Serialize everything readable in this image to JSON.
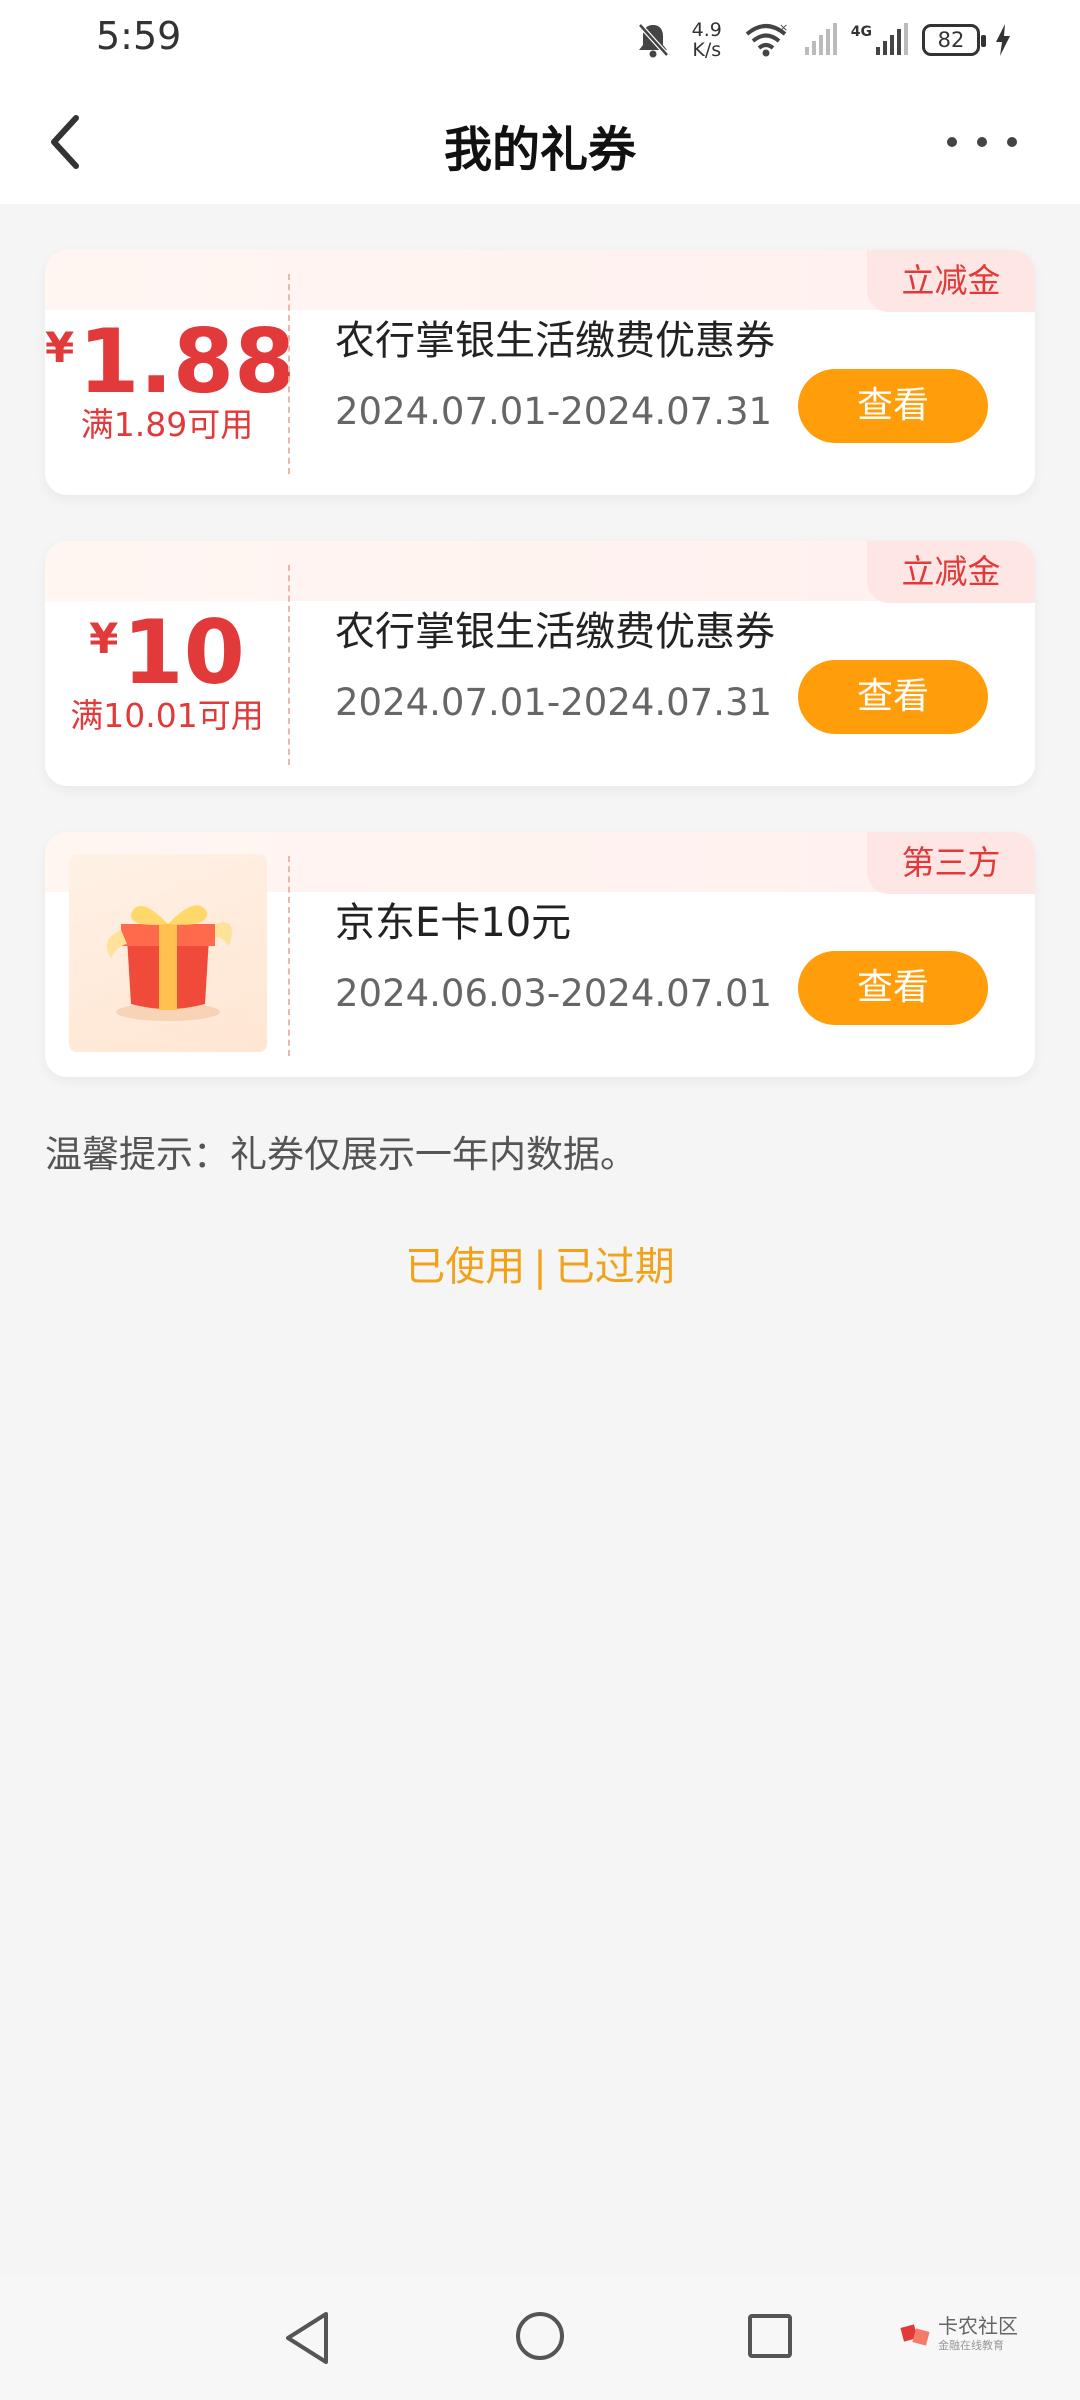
{
  "status_bar": {
    "time": "5:59",
    "net_speed_value": "4.9",
    "net_speed_unit": "K/s",
    "network_label": "4G",
    "battery": "82",
    "icons": [
      "bell-muted-icon",
      "wifi-icon",
      "signal-icon",
      "battery-icon",
      "charging-icon"
    ]
  },
  "header": {
    "title": "我的礼券",
    "back_icon": "chevron-left-icon",
    "more_icon": "more-dots-icon"
  },
  "coupons": [
    {
      "currency": "¥",
      "amount": "1.88",
      "condition": "满1.89可用",
      "title": "农行掌银生活缴费优惠券",
      "date_range": "2024.07.01-2024.07.31",
      "tag": "立减金",
      "button_label": "查看"
    },
    {
      "currency": "¥",
      "amount": "10",
      "condition": "满10.01可用",
      "title": "农行掌银生活缴费优惠券",
      "date_range": "2024.07.01-2024.07.31",
      "tag": "立减金",
      "button_label": "查看"
    },
    {
      "image": "gift-box-icon",
      "title": "京东E卡10元",
      "date_range": "2024.06.03-2024.07.01",
      "tag": "第三方",
      "button_label": "查看"
    }
  ],
  "tip": "温馨提示：礼券仅展示一年内数据。",
  "links": {
    "used": "已使用",
    "separator": "|",
    "expired": "已过期"
  },
  "watermark": {
    "main": "卡农社区",
    "sub": "金融在线教育"
  },
  "colors": {
    "accent_red": "#e2393a",
    "button_orange": "#ff9d0a",
    "link_orange": "#f0a21b",
    "tag_bg": "#fde6e3",
    "page_bg": "#f5f5f5"
  }
}
